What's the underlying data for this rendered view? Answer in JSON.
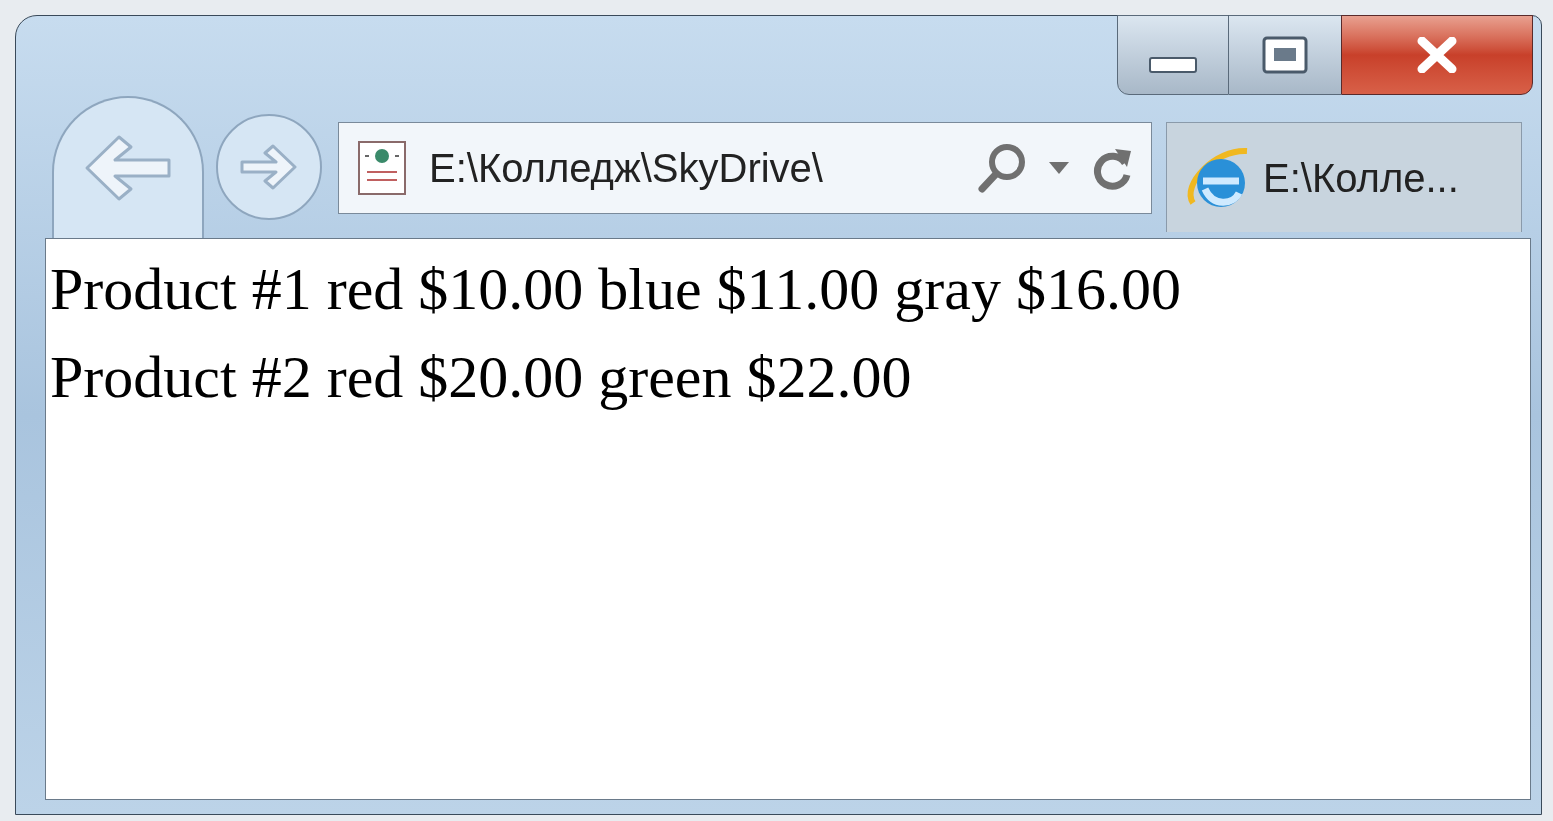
{
  "address_bar": {
    "value": "E:\\Колледж\\SkyDrive\\"
  },
  "tab": {
    "title": "E:\\Колле..."
  },
  "content": {
    "lines": [
      "Product #1 red $10.00 blue $11.00 gray $16.00",
      "Product #2 red $20.00 green $22.00"
    ]
  }
}
